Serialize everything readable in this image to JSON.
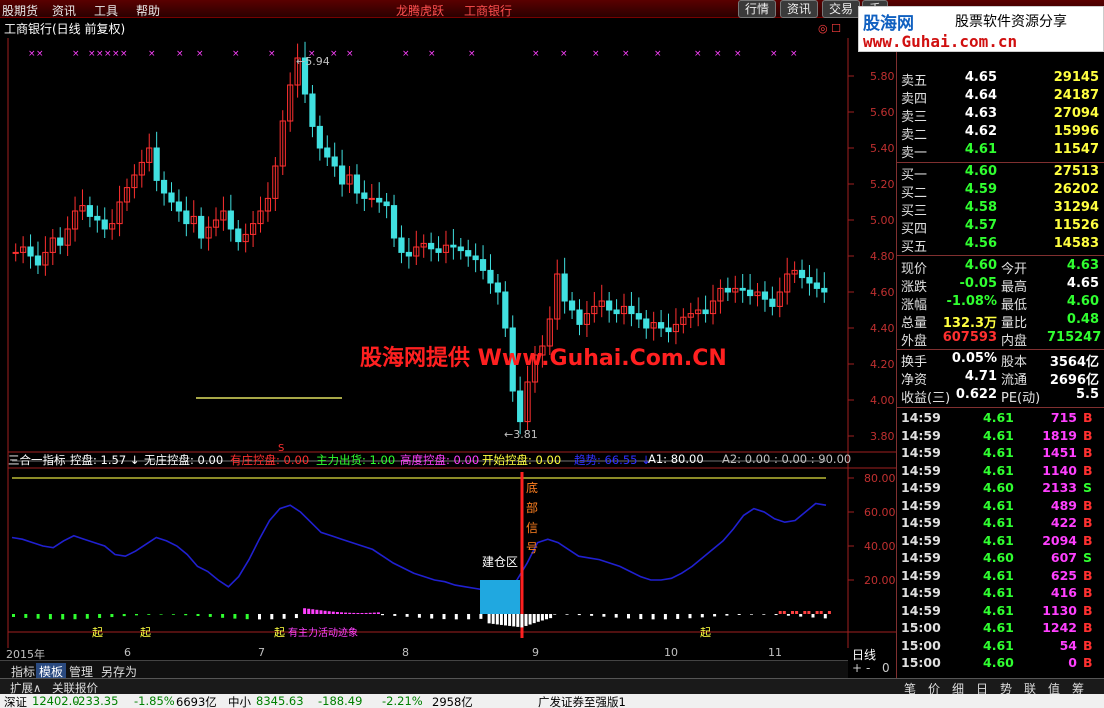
{
  "menu": {
    "items": [
      "股期货",
      "资讯",
      "工具",
      "帮助"
    ],
    "center_items": [
      "龙腾虎跃",
      "工商银行"
    ],
    "buttons": [
      "行情",
      "资讯",
      "交易",
      "手"
    ]
  },
  "logo": {
    "brand": "股海网",
    "slogan": "股票软件资源分享",
    "url": "www.Guhai.com.cn"
  },
  "title": "工商银行(日线 前复权)",
  "main_chart": {
    "price_axis": [
      "5.80",
      "5.60",
      "5.40",
      "5.20",
      "5.00",
      "4.80",
      "4.60",
      "4.40",
      "4.20",
      "4.00",
      "3.80"
    ],
    "high_label": "5.94",
    "low_label": "3.81",
    "mark": "S"
  },
  "indicator_bar": {
    "name": "三合一指标",
    "items": [
      {
        "label": "控盘: 1.57",
        "arrow": "↓",
        "color": "#ffffff"
      },
      {
        "label": "无庄控盘: 0.00",
        "color": "#ffffff"
      },
      {
        "label": "有庄控盘: 0.00",
        "color": "#ff3030"
      },
      {
        "label": "主力出货: 1.00",
        "color": "#30ff30"
      },
      {
        "label": "高度控盘: 0.00",
        "color": "#ff40ff"
      },
      {
        "label": "开始控盘: 0.00",
        "color": "#ffff40"
      },
      {
        "label": "趋势: 66.55",
        "arrow": "↓",
        "color": "#3030ff"
      },
      {
        "label": "A1: 80.00",
        "color": "#ffffff"
      },
      {
        "label": "A2: 0.00 : 0.00 : 90.00",
        "color": "#c0c0c0"
      }
    ]
  },
  "indicator_chart": {
    "axis": [
      "80.00",
      "60.00",
      "40.00",
      "20.00"
    ],
    "signal_text": [
      "底",
      "部",
      "信",
      "号"
    ],
    "zone_label": "建仓区",
    "qi_label": "起",
    "note": "有主力活动迹象"
  },
  "watermark": "股海网提供 Www.Guhai.Com.CN",
  "dates": [
    "2015年",
    "6",
    "7",
    "8",
    "9",
    "10",
    "11"
  ],
  "period": "日线",
  "period_controls": [
    "+",
    "-",
    "0"
  ],
  "bottom_tabs": [
    "指标",
    "模板",
    "管理",
    "另存为"
  ],
  "bottom_active": "模板",
  "ext_tabs": [
    "扩展∧",
    "关联报价"
  ],
  "status": [
    {
      "t": "深证",
      "c": "#000"
    },
    {
      "t": "12402.0",
      "c": "#008000"
    },
    {
      "t": "-233.35",
      "c": "#008000"
    },
    {
      "t": "-1.85%",
      "c": "#008000"
    },
    {
      "t": "6693亿",
      "c": "#000"
    },
    {
      "t": "中小",
      "c": "#000"
    },
    {
      "t": "8345.63",
      "c": "#008000"
    },
    {
      "t": "-188.49",
      "c": "#008000"
    },
    {
      "t": "-2.21%",
      "c": "#008000"
    },
    {
      "t": "2958亿",
      "c": "#000"
    },
    {
      "t": "广发证券至强版1",
      "c": "#000"
    }
  ],
  "quote": {
    "sell": [
      {
        "label": "卖五",
        "price": "4.65",
        "vol": "29145"
      },
      {
        "label": "卖四",
        "price": "4.64",
        "vol": "24187"
      },
      {
        "label": "卖三",
        "price": "4.63",
        "vol": "27094"
      },
      {
        "label": "卖二",
        "price": "4.62",
        "vol": "15996"
      },
      {
        "label": "卖一",
        "price": "4.61",
        "vol": "11547"
      }
    ],
    "buy": [
      {
        "label": "买一",
        "price": "4.60",
        "vol": "27513"
      },
      {
        "label": "买二",
        "price": "4.59",
        "vol": "26202"
      },
      {
        "label": "买三",
        "price": "4.58",
        "vol": "31294"
      },
      {
        "label": "买四",
        "price": "4.57",
        "vol": "11526"
      },
      {
        "label": "买五",
        "price": "4.56",
        "vol": "14583"
      }
    ],
    "stats": [
      {
        "l1": "现价",
        "v1": "4.60",
        "c1": "#30ff30",
        "l2": "今开",
        "v2": "4.63",
        "c2": "#30ff30"
      },
      {
        "l1": "涨跌",
        "v1": "-0.05",
        "c1": "#30ff30",
        "l2": "最高",
        "v2": "4.65",
        "c2": "#ffffff"
      },
      {
        "l1": "涨幅",
        "v1": "-1.08%",
        "c1": "#30ff30",
        "l2": "最低",
        "v2": "4.60",
        "c2": "#30ff30"
      },
      {
        "l1": "总量",
        "v1": "132.3万",
        "c1": "#ffff40",
        "l2": "量比",
        "v2": "0.48",
        "c2": "#30ff30"
      },
      {
        "l1": "外盘",
        "v1": "607593",
        "c1": "#ff3030",
        "l2": "内盘",
        "v2": "715247",
        "c2": "#30ff30"
      }
    ],
    "stats2": [
      {
        "l1": "换手",
        "v1": "0.05%",
        "l2": "股本",
        "v2": "3564亿"
      },
      {
        "l1": "净资",
        "v1": "4.71",
        "l2": "流通",
        "v2": "2696亿"
      },
      {
        "l1": "收益(三)",
        "v1": "0.622",
        "l2": "PE(动)",
        "v2": "5.5"
      }
    ],
    "ticks": [
      {
        "time": "14:59",
        "price": "4.61",
        "vol": "715",
        "side": "B"
      },
      {
        "time": "14:59",
        "price": "4.61",
        "vol": "1819",
        "side": "B"
      },
      {
        "time": "14:59",
        "price": "4.61",
        "vol": "1451",
        "side": "B"
      },
      {
        "time": "14:59",
        "price": "4.61",
        "vol": "1140",
        "side": "B"
      },
      {
        "time": "14:59",
        "price": "4.60",
        "vol": "2133",
        "side": "S"
      },
      {
        "time": "14:59",
        "price": "4.61",
        "vol": "489",
        "side": "B"
      },
      {
        "time": "14:59",
        "price": "4.61",
        "vol": "422",
        "side": "B"
      },
      {
        "time": "14:59",
        "price": "4.61",
        "vol": "2094",
        "side": "B"
      },
      {
        "time": "14:59",
        "price": "4.60",
        "vol": "607",
        "side": "S"
      },
      {
        "time": "14:59",
        "price": "4.61",
        "vol": "625",
        "side": "B"
      },
      {
        "time": "14:59",
        "price": "4.61",
        "vol": "416",
        "side": "B"
      },
      {
        "time": "14:59",
        "price": "4.61",
        "vol": "1130",
        "side": "B"
      },
      {
        "time": "15:00",
        "price": "4.61",
        "vol": "1242",
        "side": "B"
      },
      {
        "time": "15:00",
        "price": "4.61",
        "vol": "54",
        "side": "B"
      },
      {
        "time": "15:00",
        "price": "4.60",
        "vol": "0",
        "side": "B"
      }
    ],
    "panel_tabs": [
      "笔",
      "价",
      "细",
      "日",
      "势",
      "联",
      "值",
      "筹"
    ]
  }
}
